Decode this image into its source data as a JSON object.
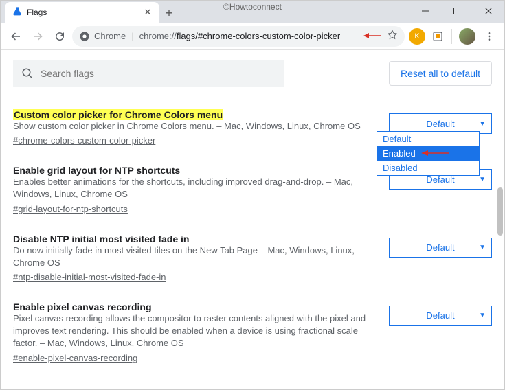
{
  "watermark": "©Howtoconnect",
  "tab": {
    "title": "Flags"
  },
  "addressbar": {
    "secure_label": "Chrome",
    "url_host": "chrome://",
    "url_path": "flags/#chrome-colors-custom-color-picker"
  },
  "avatar_letter": "K",
  "search": {
    "placeholder": "Search flags"
  },
  "reset_label": "Reset all to default",
  "dropdown_options": [
    "Default",
    "Enabled",
    "Disabled"
  ],
  "flags": [
    {
      "title": "Custom color picker for Chrome Colors menu",
      "desc": "Show custom color picker in Chrome Colors menu. – Mac, Windows, Linux, Chrome OS",
      "anchor": "#chrome-colors-custom-color-picker",
      "select": "Default"
    },
    {
      "title": "Enable grid layout for NTP shortcuts",
      "desc": "Enables better animations for the shortcuts, including improved drag-and-drop. – Mac, Windows, Linux, Chrome OS",
      "anchor": "#grid-layout-for-ntp-shortcuts",
      "select": "Default"
    },
    {
      "title": "Disable NTP initial most visited fade in",
      "desc": "Do now initially fade in most visited tiles on the New Tab Page – Mac, Windows, Linux, Chrome OS",
      "anchor": "#ntp-disable-initial-most-visited-fade-in",
      "select": "Default"
    },
    {
      "title": "Enable pixel canvas recording",
      "desc": "Pixel canvas recording allows the compositor to raster contents aligned with the pixel and improves text rendering. This should be enabled when a device is using fractional scale factor. – Mac, Windows, Linux, Chrome OS",
      "anchor": "#enable-pixel-canvas-recording",
      "select": "Default"
    }
  ]
}
